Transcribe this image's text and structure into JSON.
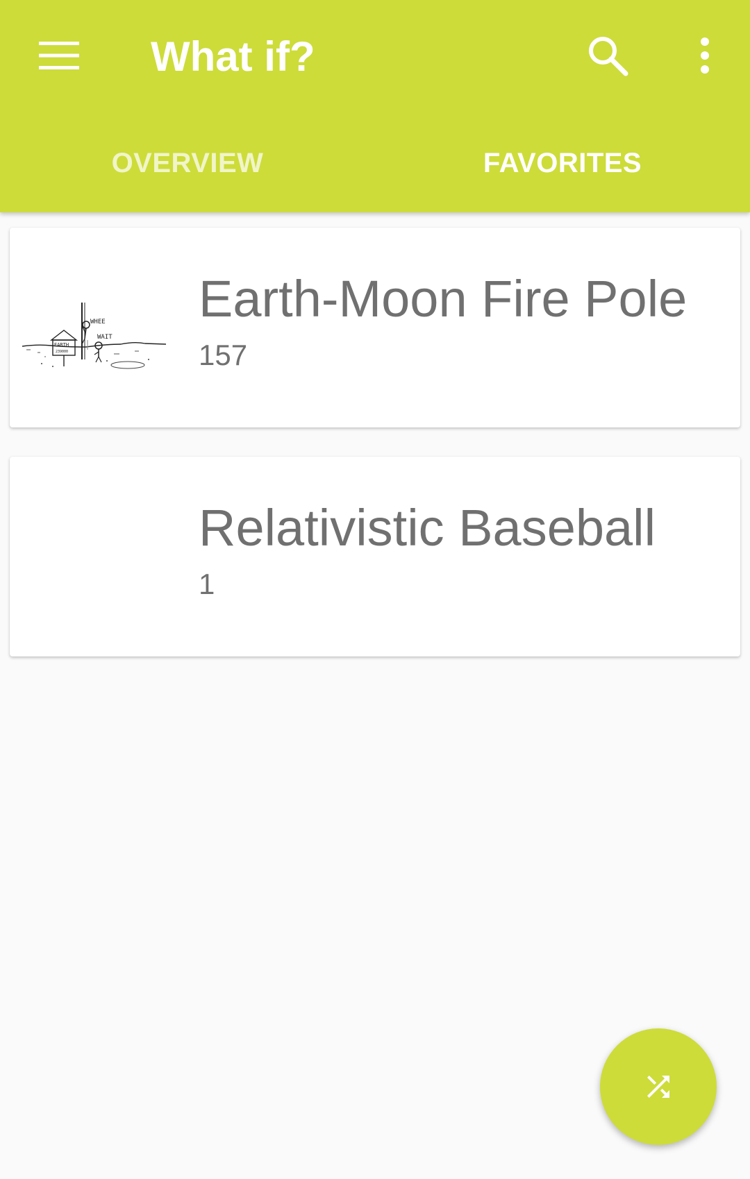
{
  "app": {
    "title": "What if?",
    "accent_color": "#cddc39"
  },
  "toolbar": {
    "menu_icon": "hamburger-menu-icon",
    "search_icon": "search-icon",
    "more_icon": "more-vertical-icon"
  },
  "tabs": [
    {
      "label": "OVERVIEW",
      "selected": false
    },
    {
      "label": "FAVORITES",
      "selected": true
    }
  ],
  "favorites": [
    {
      "title": "Earth-Moon Fire Pole",
      "number": "157",
      "has_thumbnail": true
    },
    {
      "title": "Relativistic Baseball",
      "number": "1",
      "has_thumbnail": false
    }
  ],
  "fab": {
    "icon": "shuffle-icon"
  }
}
